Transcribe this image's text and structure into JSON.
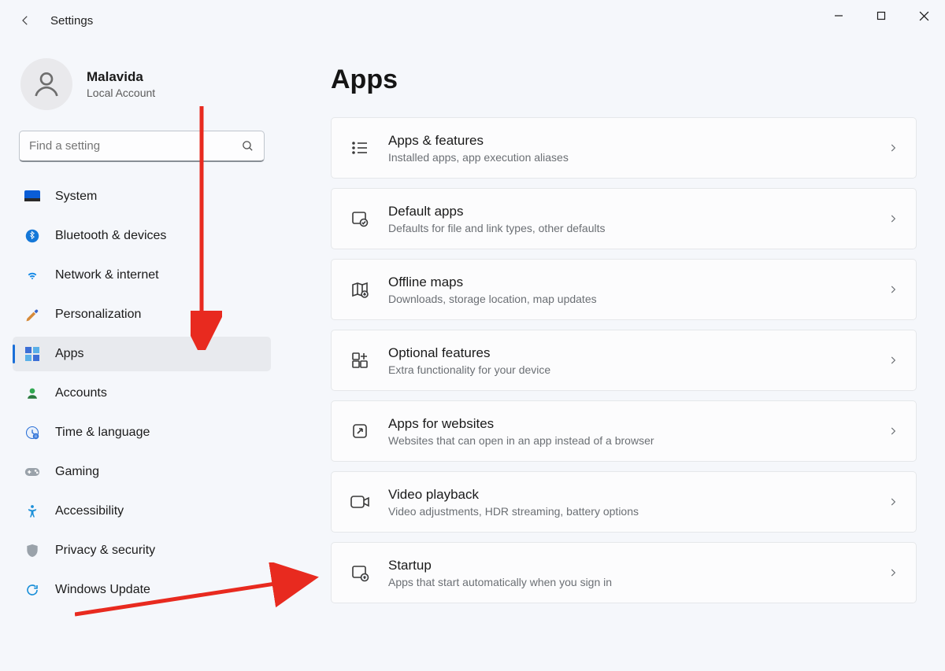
{
  "app_title": "Settings",
  "user": {
    "name": "Malavida",
    "subtitle": "Local Account"
  },
  "search": {
    "placeholder": "Find a setting"
  },
  "sidebar": {
    "items": [
      {
        "label": "System",
        "icon": "system"
      },
      {
        "label": "Bluetooth & devices",
        "icon": "bluetooth"
      },
      {
        "label": "Network & internet",
        "icon": "wifi"
      },
      {
        "label": "Personalization",
        "icon": "brush"
      },
      {
        "label": "Apps",
        "icon": "apps",
        "selected": true
      },
      {
        "label": "Accounts",
        "icon": "accounts"
      },
      {
        "label": "Time & language",
        "icon": "clock"
      },
      {
        "label": "Gaming",
        "icon": "gaming"
      },
      {
        "label": "Accessibility",
        "icon": "accessibility"
      },
      {
        "label": "Privacy & security",
        "icon": "shield"
      },
      {
        "label": "Windows Update",
        "icon": "update"
      }
    ]
  },
  "page": {
    "title": "Apps",
    "cards": [
      {
        "title": "Apps & features",
        "sub": "Installed apps, app execution aliases",
        "icon": "apps-features"
      },
      {
        "title": "Default apps",
        "sub": "Defaults for file and link types, other defaults",
        "icon": "default-apps"
      },
      {
        "title": "Offline maps",
        "sub": "Downloads, storage location, map updates",
        "icon": "offline-maps"
      },
      {
        "title": "Optional features",
        "sub": "Extra functionality for your device",
        "icon": "optional-features"
      },
      {
        "title": "Apps for websites",
        "sub": "Websites that can open in an app instead of a browser",
        "icon": "apps-for-websites"
      },
      {
        "title": "Video playback",
        "sub": "Video adjustments, HDR streaming, battery options",
        "icon": "video-playback"
      },
      {
        "title": "Startup",
        "sub": "Apps that start automatically when you sign in",
        "icon": "startup"
      }
    ]
  },
  "annotation": {
    "color": "#e82a1f"
  }
}
